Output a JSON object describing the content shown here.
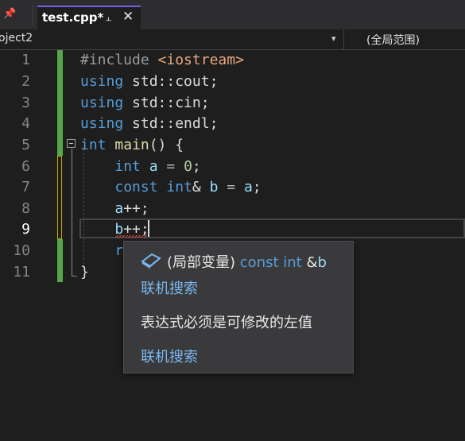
{
  "tabs": [
    {
      "label": "test.cpp*",
      "active": true
    }
  ],
  "nav": {
    "project": "oject2",
    "scope": "(全局范围)"
  },
  "editor": {
    "line_numbers": [
      "1",
      "2",
      "3",
      "4",
      "5",
      "6",
      "7",
      "8",
      "9",
      "10",
      "11"
    ],
    "current_line": 9,
    "line1": {
      "a": "#include",
      "b": "<iostream>"
    },
    "line2": {
      "a": "using",
      "b": "std::cout;"
    },
    "line3": {
      "a": "using",
      "b": "std::cin;"
    },
    "line4": {
      "a": "using",
      "b": "std::endl;"
    },
    "line5": {
      "a": "int",
      "b": "main",
      "c": "() {"
    },
    "line6": {
      "a": "int",
      "b": "a",
      "c": " = ",
      "d": "0",
      "e": ";"
    },
    "line7": {
      "a": "const",
      "b": "int",
      "c": "&",
      "d": "b",
      "e": " = ",
      "f": "a",
      "g": ";"
    },
    "line8": {
      "a": "a",
      "b": "++;"
    },
    "line9": {
      "a": "b",
      "b": "++;"
    },
    "line10": {
      "a": "r"
    },
    "line11": {
      "a": "}"
    }
  },
  "quickinfo": {
    "icon": "variable-icon",
    "sig_scope": "(局部变量)",
    "sig_type": "const int",
    "sig_amp": "&",
    "sig_name": "b",
    "search_link_1": "联机搜索",
    "error_message": "表达式必须是可修改的左值",
    "search_link_2": "联机搜索"
  },
  "colors": {
    "background": "#1e1e1e",
    "keyword": "#569cd6",
    "variable": "#9cdcfe",
    "function": "#dcdcaa",
    "number": "#b5cea8",
    "change_saved": "#57a64a",
    "change_unsaved": "#c9a800",
    "tab_accent": "#7160e8",
    "error": "#f44747"
  }
}
